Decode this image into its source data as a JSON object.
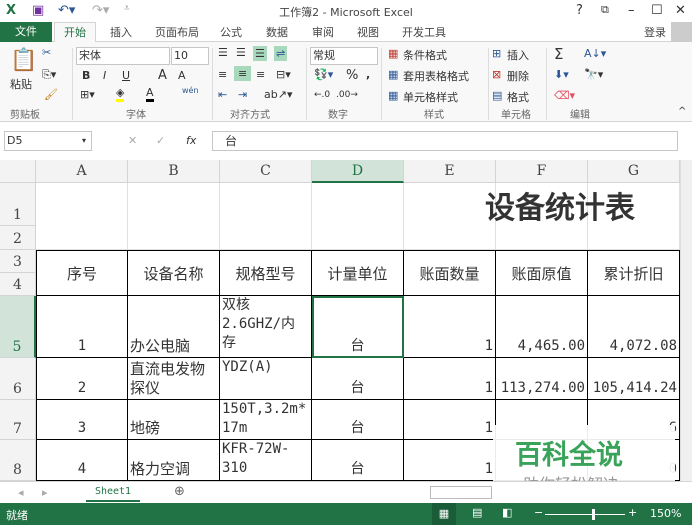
{
  "window": {
    "title": "工作簿2 - Microsoft Excel",
    "help": "?",
    "signin": "登录"
  },
  "tabs": [
    "文件",
    "开始",
    "插入",
    "页面布局",
    "公式",
    "数据",
    "审阅",
    "视图",
    "开发工具"
  ],
  "ribbon": {
    "clipboard": {
      "paste": "粘贴",
      "label": "剪贴板"
    },
    "font": {
      "name": "宋体",
      "size": "10",
      "bold": "B",
      "italic": "I",
      "underline": "U",
      "grow": "A",
      "shrink": "A",
      "wen": "wén",
      "label": "字体"
    },
    "alignment": {
      "label": "对齐方式"
    },
    "number": {
      "format": "常规",
      "percent": "%",
      "comma": ",",
      "label": "数字"
    },
    "styles": {
      "conditional": "条件格式",
      "table": "套用表格格式",
      "cell": "单元格样式",
      "label": "样式"
    },
    "cells": {
      "insert": "插入",
      "delete": "删除",
      "format": "格式",
      "label": "单元格"
    },
    "editing": {
      "sum": "Σ",
      "label": "编辑"
    }
  },
  "formula_bar": {
    "name_box": "D5",
    "fx": "fx",
    "value": "台"
  },
  "columns": [
    "A",
    "B",
    "C",
    "D",
    "E",
    "F",
    "G"
  ],
  "rows": [
    "1",
    "2",
    "3",
    "4",
    "5",
    "6",
    "7",
    "8"
  ],
  "sheet": {
    "title": "设备统计表",
    "headers": [
      "序号",
      "设备名称",
      "规格型号",
      "计量单位",
      "账面数量",
      "账面原值",
      "累计折旧"
    ],
    "data": [
      [
        "1",
        "办公电脑",
        "双核\n2.6GHZ/内\n存",
        "台",
        "1",
        "4,465.00",
        "4,072.08"
      ],
      [
        "2",
        "直流电发物\n探仪",
        "YDZ(A)",
        "台",
        "1",
        "113,274.00",
        "105,414.24"
      ],
      [
        "3",
        "地磅",
        "150T,3.2m*\n17m",
        "台",
        "1",
        "",
        "6"
      ],
      [
        "4",
        "格力空调",
        "KFR-72W-\n310",
        "台",
        "1",
        "",
        "0"
      ]
    ]
  },
  "sheet_tabs": [
    "Sheet1"
  ],
  "status": {
    "ready": "就绪",
    "zoom": "150%"
  },
  "watermark": {
    "title": "百科全说",
    "subtitle": "助你轻松解决"
  },
  "colors": {
    "accent": "#217346"
  }
}
